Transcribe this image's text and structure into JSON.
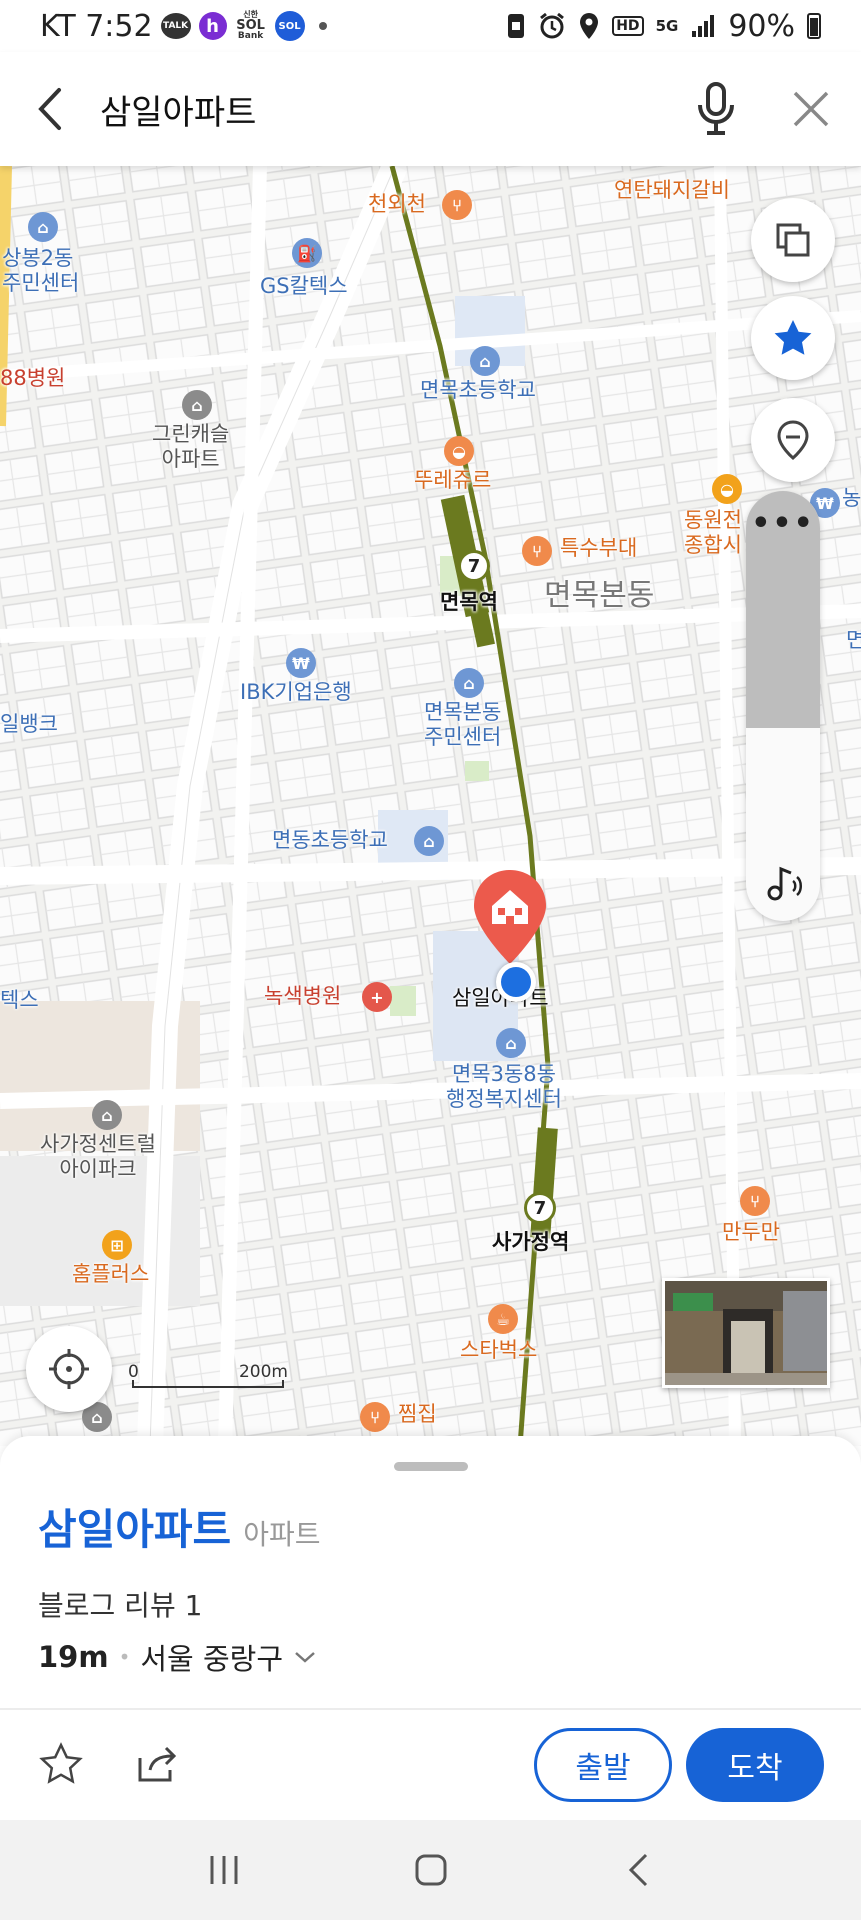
{
  "status_bar": {
    "carrier_time": "KT 7:52",
    "talk_label": "TALK",
    "h_label": "h",
    "sol_small": "신한",
    "sol_label": "SOL",
    "bank_label": "Bank",
    "supersol_label": "SOL",
    "hd_label": "HD",
    "network_label": "5G",
    "battery": "90%"
  },
  "search": {
    "query": "삼일아파트"
  },
  "map": {
    "pois": {
      "cheonoecheon": "천외천",
      "yeontan": "연탄돼지갈비",
      "sangbong_center": "상봉2동\n주민센터",
      "gs": "GS칼텍스",
      "hospital88": "88병원",
      "myeonmok_elem": "면목초등학교",
      "green_castle": "그린캐슬\n아파트",
      "tourejour": "뚜레쥬르",
      "dongwon": "동원전\n종합시",
      "special_budae": "특수부대",
      "myeonmok_station": "면목역",
      "myeonmok_bondong": "면목본동",
      "ibk": "IBK기업은행",
      "myeonmok_center": "면목본동\n주민센터",
      "ilbank": "일뱅크",
      "myeondong_elem": "면동초등학교",
      "noksaek": "녹색병원",
      "samil_label": "삼일아파트",
      "tex": "텍스",
      "welfare": "면목3동8동\n행정복지센터",
      "sagajeong_central": "사가정센트럴\n아이파크",
      "sagajeong_station": "사가정역",
      "mandu": "만두만",
      "homeplus": "홈플러스",
      "starbucks": "스타벅스",
      "jjimjil": "찜집",
      "nong_partial": "농",
      "myeon_partial": "면"
    },
    "line_number": "7",
    "scale_zero": "0",
    "scale_max": "200m",
    "volume_level": 0.55
  },
  "sheet": {
    "name": "삼일아파트",
    "category": "아파트",
    "review": "블로그 리뷰 1",
    "distance": "19m",
    "address": "서울 중랑구",
    "depart_label": "출발",
    "arrive_label": "도착"
  },
  "colors": {
    "accent": "#1763d6",
    "subway_line7": "#6b7a1f",
    "poi_orange": "#d9691f",
    "poi_blue": "#3d6fb6"
  }
}
